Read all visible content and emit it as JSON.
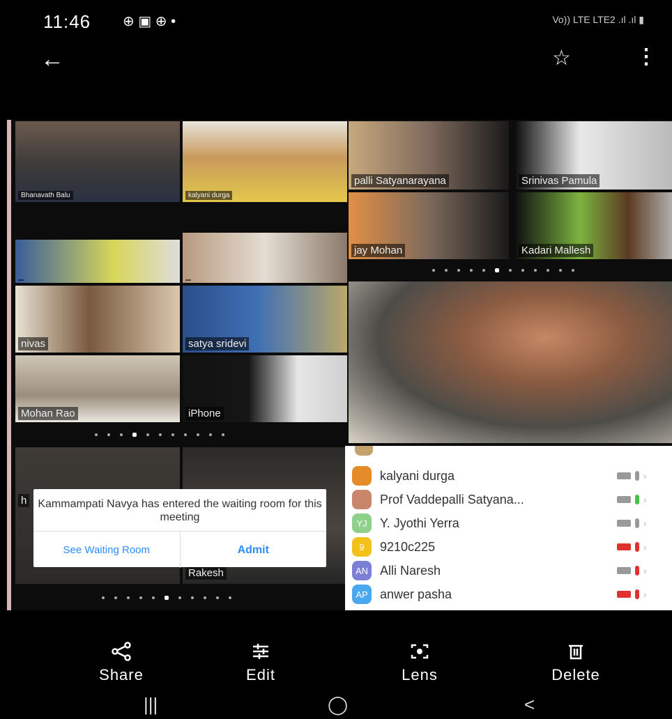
{
  "status_bar": {
    "time": "11:46",
    "left_icons": "⊕ ▣ ⊕ •",
    "right_text": "Vo)) LTE LTE2 .ıl .ıl ▮"
  },
  "top_bar": {
    "back_icon": "arrow-left",
    "favorite_icon": "star-outline",
    "more_icon": "more-vertical"
  },
  "video_tiles": {
    "left_grid": [
      {
        "name": "Bhanavath Balu"
      },
      {
        "name": "kalyani durga"
      },
      {
        "name": ""
      },
      {
        "name": ""
      }
    ],
    "right_grid": [
      {
        "name": "palli Satyanarayana"
      },
      {
        "name": "Srinivas Pamula"
      },
      {
        "name": "jay Mohan"
      },
      {
        "name": "Kadari Mallesh"
      }
    ],
    "mid_left_grid": [
      {
        "name": "nivas"
      },
      {
        "name": "satya sridevi"
      },
      {
        "name": "Mohan Rao"
      },
      {
        "name": "iPhone"
      }
    ],
    "bottom_left_grid": [
      {
        "name": "h"
      },
      {
        "name": "Rakesh"
      }
    ]
  },
  "participants": [
    {
      "name": "kalyani durga",
      "initials": "",
      "avatar_color": "#e58b2a",
      "cam_color": "#999999",
      "mic_color": "#999999"
    },
    {
      "name": "Prof Vaddepalli Satyana...",
      "initials": "",
      "avatar_color": "#c9866b",
      "cam_color": "#999999",
      "mic_color": "#46c346"
    },
    {
      "name": "Y. Jyothi Yerra",
      "initials": "YJ",
      "avatar_color": "#8fd18a",
      "cam_color": "#999999",
      "mic_color": "#999999"
    },
    {
      "name": "9210c225",
      "initials": "9",
      "avatar_color": "#f2c21b",
      "cam_color": "#e0312f",
      "mic_color": "#e0312f"
    },
    {
      "name": "Alli Naresh",
      "initials": "AN",
      "avatar_color": "#7b7fd6",
      "cam_color": "#999999",
      "mic_color": "#e0312f"
    },
    {
      "name": "anwer pasha",
      "initials": "AP",
      "avatar_color": "#4aa8f0",
      "cam_color": "#e0312f",
      "mic_color": "#e0312f"
    }
  ],
  "dialog": {
    "message": "Kammampati Navya has entered the waiting room for this meeting",
    "see_waiting_room": "See Waiting Room",
    "admit": "Admit"
  },
  "actions": {
    "share": "Share",
    "edit": "Edit",
    "lens": "Lens",
    "delete": "Delete"
  },
  "nav": {
    "recents": "|||",
    "home": "◯",
    "back": "<"
  }
}
